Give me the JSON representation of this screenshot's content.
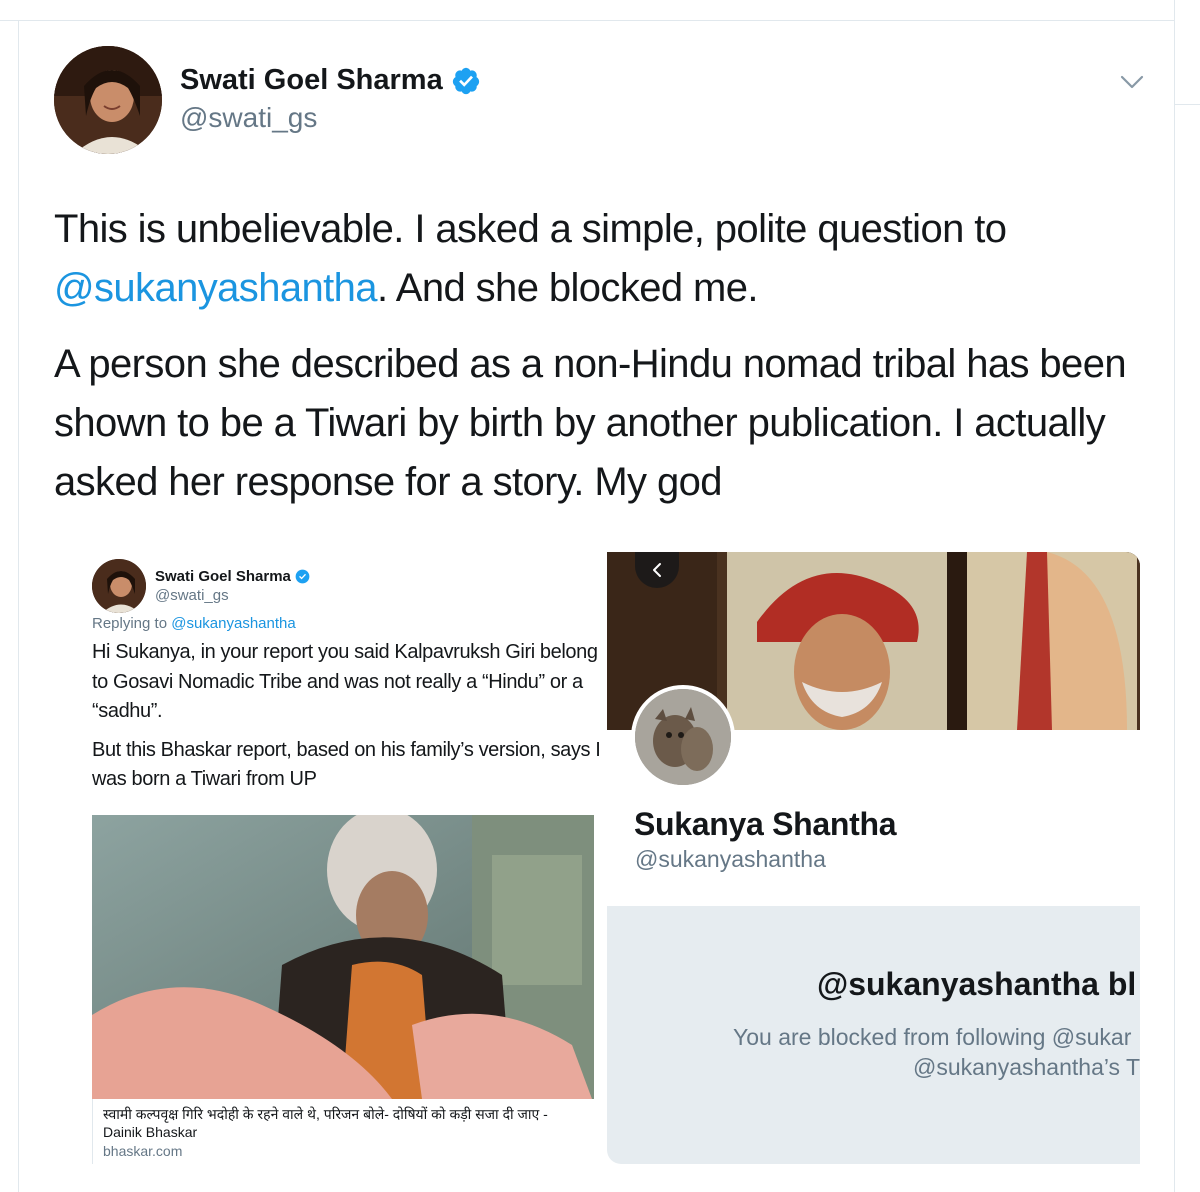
{
  "tweet": {
    "author_name": "Swati Goel Sharma",
    "author_handle": "@swati_gs",
    "text_line1_prefix": "This is unbelievable. I asked a simple, polite question to",
    "text_mention": "@sukanyashantha",
    "text_line2_suffix": ". And she blocked me.",
    "text_paragraph2": "A person she described as a non-Hindu nomad tribal has been shown to be a Tiwari by birth by another publication. I actually asked her response for a story. My god"
  },
  "embedded_tweet": {
    "author_name": "Swati Goel Sharma",
    "author_handle": "@swati_gs",
    "replying_prefix": "Replying to",
    "replying_to": "@sukanyashantha",
    "paragraph1": "Hi Sukanya, in your report you said Kalpavruksh Giri belong to Gosavi Nomadic Tribe and was not really a “Hindu” or a “sadhu”.",
    "paragraph2": "But this Bhaskar report, based on his family’s version, says I was born a Tiwari from UP",
    "card_title": "स्वामी कल्पवृक्ष गिरि भदोही के रहने वाले थे, परिजन बोले- दोषियों को कड़ी सजा दी जाए - Dainik Bhaskar",
    "card_domain": "bhaskar.com"
  },
  "blocked_profile": {
    "name": "Sukanya Shantha",
    "handle": "@sukanyashantha",
    "blocked_title": "@sukanyashantha bl",
    "blocked_line1": "You are blocked from following @sukar",
    "blocked_line2": "@sukanyashantha’s T"
  },
  "colors": {
    "link": "#1b95e0",
    "verified": "#1da1f2",
    "secondary_text": "#657786",
    "panel_bg": "#e6ecf0"
  },
  "icons": [
    "verified-badge-icon",
    "chevron-down-icon",
    "back-arrow-icon"
  ]
}
